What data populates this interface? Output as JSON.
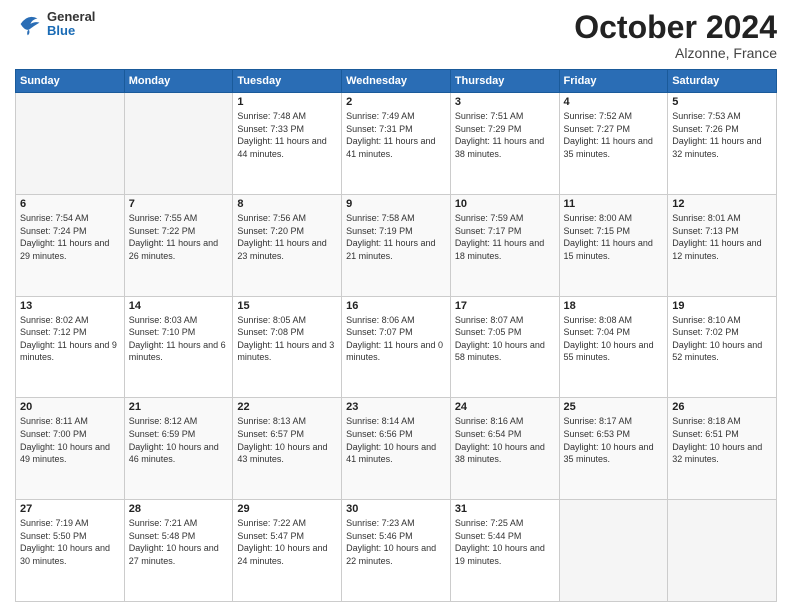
{
  "header": {
    "logo": {
      "general": "General",
      "blue": "Blue"
    },
    "title": "October 2024",
    "location": "Alzonne, France"
  },
  "weekdays": [
    "Sunday",
    "Monday",
    "Tuesday",
    "Wednesday",
    "Thursday",
    "Friday",
    "Saturday"
  ],
  "weeks": [
    [
      {
        "day": "",
        "info": ""
      },
      {
        "day": "",
        "info": ""
      },
      {
        "day": "1",
        "info": "Sunrise: 7:48 AM\nSunset: 7:33 PM\nDaylight: 11 hours and 44 minutes."
      },
      {
        "day": "2",
        "info": "Sunrise: 7:49 AM\nSunset: 7:31 PM\nDaylight: 11 hours and 41 minutes."
      },
      {
        "day": "3",
        "info": "Sunrise: 7:51 AM\nSunset: 7:29 PM\nDaylight: 11 hours and 38 minutes."
      },
      {
        "day": "4",
        "info": "Sunrise: 7:52 AM\nSunset: 7:27 PM\nDaylight: 11 hours and 35 minutes."
      },
      {
        "day": "5",
        "info": "Sunrise: 7:53 AM\nSunset: 7:26 PM\nDaylight: 11 hours and 32 minutes."
      }
    ],
    [
      {
        "day": "6",
        "info": "Sunrise: 7:54 AM\nSunset: 7:24 PM\nDaylight: 11 hours and 29 minutes."
      },
      {
        "day": "7",
        "info": "Sunrise: 7:55 AM\nSunset: 7:22 PM\nDaylight: 11 hours and 26 minutes."
      },
      {
        "day": "8",
        "info": "Sunrise: 7:56 AM\nSunset: 7:20 PM\nDaylight: 11 hours and 23 minutes."
      },
      {
        "day": "9",
        "info": "Sunrise: 7:58 AM\nSunset: 7:19 PM\nDaylight: 11 hours and 21 minutes."
      },
      {
        "day": "10",
        "info": "Sunrise: 7:59 AM\nSunset: 7:17 PM\nDaylight: 11 hours and 18 minutes."
      },
      {
        "day": "11",
        "info": "Sunrise: 8:00 AM\nSunset: 7:15 PM\nDaylight: 11 hours and 15 minutes."
      },
      {
        "day": "12",
        "info": "Sunrise: 8:01 AM\nSunset: 7:13 PM\nDaylight: 11 hours and 12 minutes."
      }
    ],
    [
      {
        "day": "13",
        "info": "Sunrise: 8:02 AM\nSunset: 7:12 PM\nDaylight: 11 hours and 9 minutes."
      },
      {
        "day": "14",
        "info": "Sunrise: 8:03 AM\nSunset: 7:10 PM\nDaylight: 11 hours and 6 minutes."
      },
      {
        "day": "15",
        "info": "Sunrise: 8:05 AM\nSunset: 7:08 PM\nDaylight: 11 hours and 3 minutes."
      },
      {
        "day": "16",
        "info": "Sunrise: 8:06 AM\nSunset: 7:07 PM\nDaylight: 11 hours and 0 minutes."
      },
      {
        "day": "17",
        "info": "Sunrise: 8:07 AM\nSunset: 7:05 PM\nDaylight: 10 hours and 58 minutes."
      },
      {
        "day": "18",
        "info": "Sunrise: 8:08 AM\nSunset: 7:04 PM\nDaylight: 10 hours and 55 minutes."
      },
      {
        "day": "19",
        "info": "Sunrise: 8:10 AM\nSunset: 7:02 PM\nDaylight: 10 hours and 52 minutes."
      }
    ],
    [
      {
        "day": "20",
        "info": "Sunrise: 8:11 AM\nSunset: 7:00 PM\nDaylight: 10 hours and 49 minutes."
      },
      {
        "day": "21",
        "info": "Sunrise: 8:12 AM\nSunset: 6:59 PM\nDaylight: 10 hours and 46 minutes."
      },
      {
        "day": "22",
        "info": "Sunrise: 8:13 AM\nSunset: 6:57 PM\nDaylight: 10 hours and 43 minutes."
      },
      {
        "day": "23",
        "info": "Sunrise: 8:14 AM\nSunset: 6:56 PM\nDaylight: 10 hours and 41 minutes."
      },
      {
        "day": "24",
        "info": "Sunrise: 8:16 AM\nSunset: 6:54 PM\nDaylight: 10 hours and 38 minutes."
      },
      {
        "day": "25",
        "info": "Sunrise: 8:17 AM\nSunset: 6:53 PM\nDaylight: 10 hours and 35 minutes."
      },
      {
        "day": "26",
        "info": "Sunrise: 8:18 AM\nSunset: 6:51 PM\nDaylight: 10 hours and 32 minutes."
      }
    ],
    [
      {
        "day": "27",
        "info": "Sunrise: 7:19 AM\nSunset: 5:50 PM\nDaylight: 10 hours and 30 minutes."
      },
      {
        "day": "28",
        "info": "Sunrise: 7:21 AM\nSunset: 5:48 PM\nDaylight: 10 hours and 27 minutes."
      },
      {
        "day": "29",
        "info": "Sunrise: 7:22 AM\nSunset: 5:47 PM\nDaylight: 10 hours and 24 minutes."
      },
      {
        "day": "30",
        "info": "Sunrise: 7:23 AM\nSunset: 5:46 PM\nDaylight: 10 hours and 22 minutes."
      },
      {
        "day": "31",
        "info": "Sunrise: 7:25 AM\nSunset: 5:44 PM\nDaylight: 10 hours and 19 minutes."
      },
      {
        "day": "",
        "info": ""
      },
      {
        "day": "",
        "info": ""
      }
    ]
  ]
}
